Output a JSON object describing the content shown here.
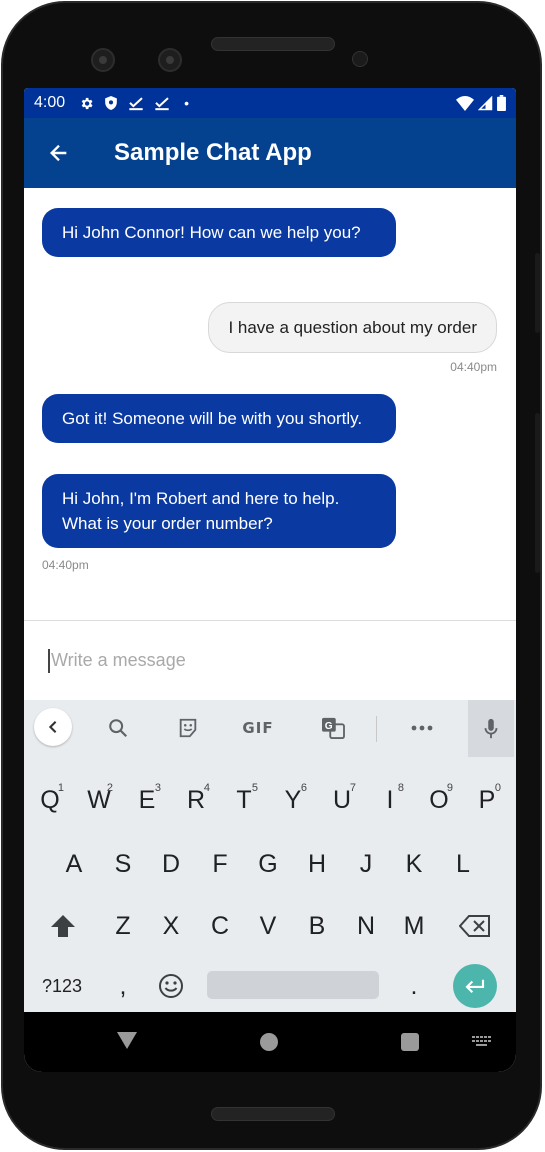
{
  "status_bar": {
    "time": "4:00",
    "dot": "•",
    "icons_left": [
      "gear-icon",
      "shield-icon",
      "check-icon",
      "check-icon",
      "dot-icon"
    ],
    "icons_right": [
      "wifi-icon",
      "signal-icon",
      "battery-icon"
    ]
  },
  "app_bar": {
    "title": "Sample Chat App",
    "back_icon": "arrow-back-icon"
  },
  "colors": {
    "status_bar": "#003399",
    "app_bar": "#04418e",
    "agent_bubble": "#0a3aa1",
    "user_bubble": "#f3f3f3",
    "enter_key": "#4db6ac",
    "keyboard_bg": "#e9ecef"
  },
  "messages": [
    {
      "sender": "agent",
      "text": "Hi John Connor! How can we help you?"
    },
    {
      "sender": "user",
      "text": "I have a question about my order",
      "time": "04:40pm"
    },
    {
      "sender": "agent",
      "text": "Got it! Someone will be with you shortly."
    },
    {
      "sender": "agent",
      "text": "Hi John, I'm Robert and here to help. What is your order number?",
      "time": "04:40pm"
    }
  ],
  "composer": {
    "placeholder": "Write a message"
  },
  "keyboard": {
    "toolbar": [
      "chevron-left-icon",
      "search-icon",
      "sticker-icon",
      "GIF",
      "translate-icon",
      "more-icon",
      "mic-icon"
    ],
    "gif_label": "GIF",
    "row1": [
      {
        "key": "Q",
        "hint": "1"
      },
      {
        "key": "W",
        "hint": "2"
      },
      {
        "key": "E",
        "hint": "3"
      },
      {
        "key": "R",
        "hint": "4"
      },
      {
        "key": "T",
        "hint": "5"
      },
      {
        "key": "Y",
        "hint": "6"
      },
      {
        "key": "U",
        "hint": "7"
      },
      {
        "key": "I",
        "hint": "8"
      },
      {
        "key": "O",
        "hint": "9"
      },
      {
        "key": "P",
        "hint": "0"
      }
    ],
    "row2": [
      "A",
      "S",
      "D",
      "F",
      "G",
      "H",
      "J",
      "K",
      "L"
    ],
    "row3": [
      "Z",
      "X",
      "C",
      "V",
      "B",
      "N",
      "M"
    ],
    "row4": {
      "symbols": "?123",
      "comma": ",",
      "period": "."
    },
    "icons": [
      "shift-icon",
      "backspace-icon",
      "emoji-icon",
      "enter-icon"
    ]
  },
  "nav_bar": {
    "icons": [
      "nav-back-icon",
      "nav-home-icon",
      "nav-recents-icon",
      "keyboard-hide-icon"
    ]
  }
}
